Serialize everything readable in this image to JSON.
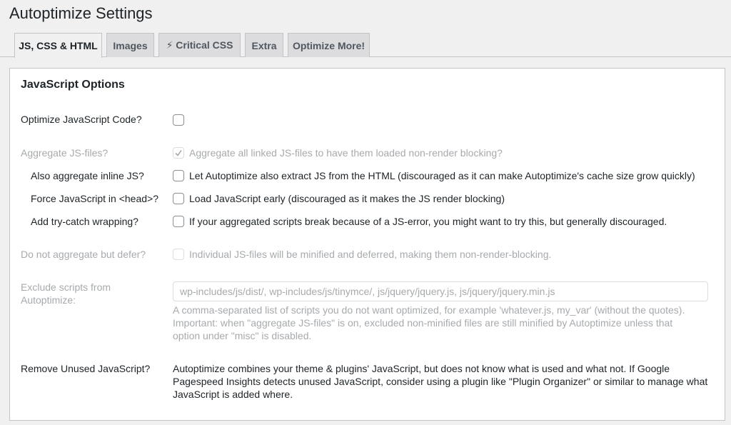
{
  "page": {
    "title": "Autoptimize Settings"
  },
  "tabs": [
    {
      "label": "JS, CSS & HTML",
      "active": true
    },
    {
      "label": "Images",
      "active": false
    },
    {
      "label": "⚡ Critical CSS",
      "active": false
    },
    {
      "label": "Extra",
      "active": false
    },
    {
      "label": "Optimize More!",
      "active": false
    }
  ],
  "section": {
    "title": "JavaScript Options",
    "optimize_js": {
      "label": "Optimize JavaScript Code?",
      "checked": false
    },
    "aggregate": {
      "label": "Aggregate JS-files?",
      "checkbox_label": "Aggregate all linked JS-files to have them loaded non-render blocking?",
      "checked": true,
      "disabled": true
    },
    "inline_js": {
      "label": "Also aggregate inline JS?",
      "checkbox_label": "Let Autoptimize also extract JS from the HTML (discouraged as it can make Autoptimize's cache size grow quickly)",
      "checked": false
    },
    "force_head": {
      "label": "Force JavaScript in <head>?",
      "checkbox_label": "Load JavaScript early (discouraged as it makes the JS render blocking)",
      "checked": false
    },
    "try_catch": {
      "label": "Add try-catch wrapping?",
      "checkbox_label": "If your aggregated scripts break because of a JS-error, you might want to try this, but generally discouraged.",
      "checked": false
    },
    "defer": {
      "label": "Do not aggregate but defer?",
      "checkbox_label": "Individual JS-files will be minified and deferred, making them non-render-blocking.",
      "checked": false,
      "disabled": true
    },
    "exclude": {
      "label": "Exclude scripts from Autoptimize:",
      "value": "wp-includes/js/dist/, wp-includes/js/tinymce/, js/jquery/jquery.js, js/jquery/jquery.min.js",
      "help": "A comma-separated list of scripts you do not want optimized, for example 'whatever.js, my_var' (without the quotes). Important: when \"aggregate JS-files\" is on, excluded non-minified files are still minified by Autoptimize unless that option under \"misc\" is disabled."
    },
    "remove_unused": {
      "label": "Remove Unused JavaScript?",
      "text": "Autoptimize combines your theme & plugins' JavaScript, but does not know what is used and what not. If Google Pagespeed Insights detects unused JavaScript, consider using a plugin like \"Plugin Organizer\" or similar to manage what JavaScript is added where."
    }
  },
  "colors": {
    "text": "#1d2327",
    "disabled_text": "#a7aaad",
    "tab_inactive_bg": "#dcdcde",
    "page_bg": "#f0f0f1"
  }
}
